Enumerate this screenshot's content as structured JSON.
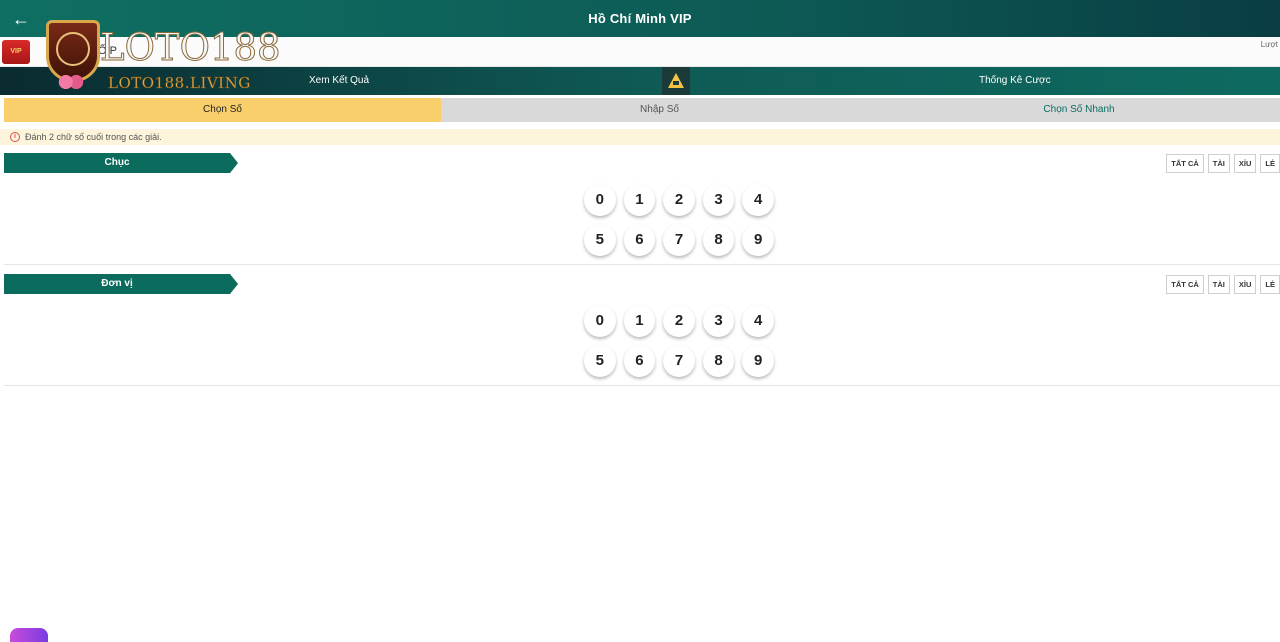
{
  "header": {
    "back_label": "←",
    "title": "Hồ Chí Minh VIP"
  },
  "subbar": {
    "left_text": "Ố P",
    "right_text": "Lượt"
  },
  "nav": {
    "left_label": "Xem Kết Quả",
    "right_label": "Thống Kê Cược"
  },
  "logo": {
    "badge_text": "VIP",
    "brand_text": "LOTO188",
    "site_text": "LOTO188.LIVING"
  },
  "tabs": [
    {
      "label": "Chọn Số"
    },
    {
      "label": "Nhập Số"
    },
    {
      "label": "Chọn Số Nhanh"
    }
  ],
  "notice": {
    "icon": "i",
    "text": "Đánh 2 chữ số cuối trong các giải."
  },
  "filters": {
    "all": "TẤT CẢ",
    "big": "TÀI",
    "small": "XỈU",
    "odd": "LẺ"
  },
  "sections": [
    {
      "title": "Chục",
      "rows": [
        [
          "0",
          "1",
          "2",
          "3",
          "4"
        ],
        [
          "5",
          "6",
          "7",
          "8",
          "9"
        ]
      ]
    },
    {
      "title": "Đơn vị",
      "rows": [
        [
          "0",
          "1",
          "2",
          "3",
          "4"
        ],
        [
          "5",
          "6",
          "7",
          "8",
          "9"
        ]
      ]
    }
  ]
}
